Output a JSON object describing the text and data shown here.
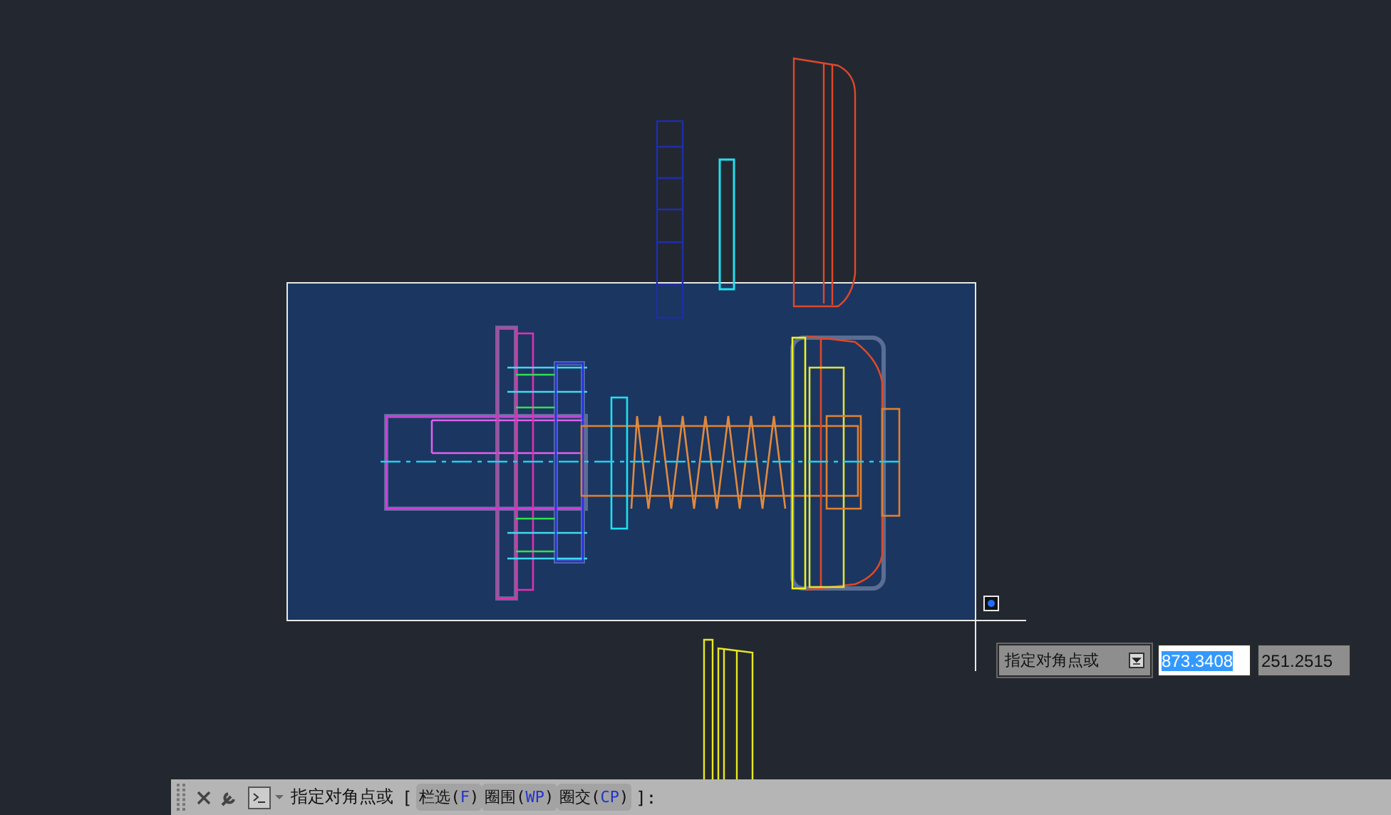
{
  "dynamic_input": {
    "prompt": "指定对角点或",
    "fields": [
      {
        "value": "873.3408",
        "selected": true
      },
      {
        "value": "251.2515",
        "selected": false
      }
    ]
  },
  "command_line": {
    "prompt": "指定对角点或",
    "open": "[",
    "close": "]:",
    "options": [
      {
        "label": "栏选(",
        "key": "F",
        "end": ")"
      },
      {
        "label": "圈围(",
        "key": "WP",
        "end": ")"
      },
      {
        "label": "圈交(",
        "key": "CP",
        "end": ")"
      }
    ]
  }
}
